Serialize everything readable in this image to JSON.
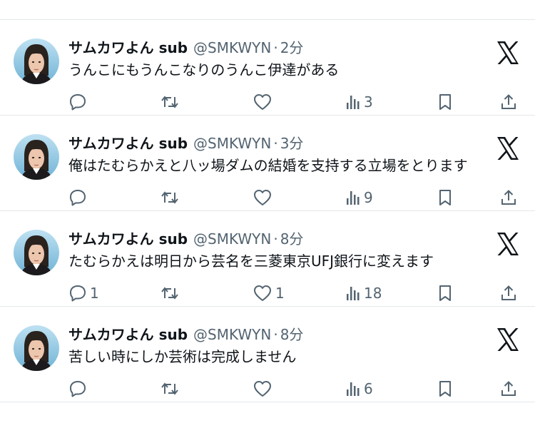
{
  "colors": {
    "text": "#0f1419",
    "muted": "#536471",
    "divider": "#e4e7ea",
    "background": "#ffffff"
  },
  "tweets": [
    {
      "name": "サムカワよん sub",
      "handle": "@SMKWYN",
      "dot": "·",
      "time": "2分",
      "text": "うんこにもうんこなりのうんこ伊達がある",
      "replies": "",
      "retweets": "",
      "likes": "",
      "views": "3",
      "logo_icon": "x-logo-icon"
    },
    {
      "name": "サムカワよん sub",
      "handle": "@SMKWYN",
      "dot": "·",
      "time": "3分",
      "text": "俺はたむらかえと八ッ場ダムの結婚を支持する立場をとります",
      "replies": "",
      "retweets": "",
      "likes": "",
      "views": "9",
      "logo_icon": "x-logo-icon"
    },
    {
      "name": "サムカワよん sub",
      "handle": "@SMKWYN",
      "dot": "·",
      "time": "8分",
      "text": "たむらかえは明日から芸名を三菱東京UFJ銀行に変えます",
      "replies": "1",
      "retweets": "",
      "likes": "1",
      "views": "18",
      "logo_icon": "x-logo-icon"
    },
    {
      "name": "サムカワよん sub",
      "handle": "@SMKWYN",
      "dot": "·",
      "time": "8分",
      "text": "苦しい時にしか芸術は完成しません",
      "replies": "",
      "retweets": "",
      "likes": "",
      "views": "6",
      "logo_icon": "x-logo-icon"
    }
  ]
}
